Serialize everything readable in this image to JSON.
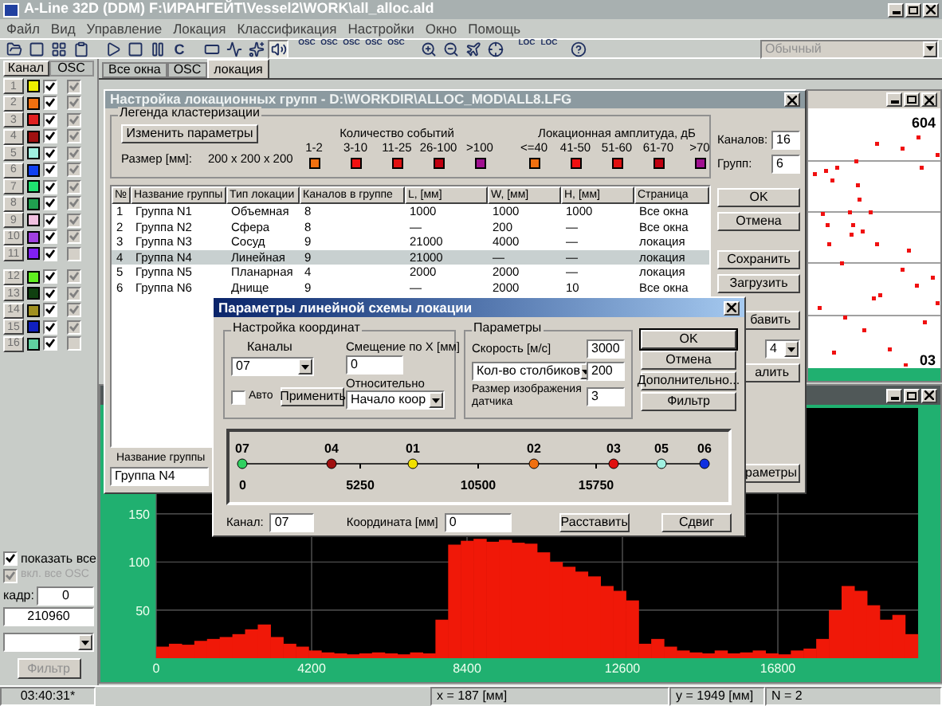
{
  "window": {
    "title": "A-Line 32D (DDM) F:\\ИРАНГЕЙТ\\Vessel2\\WORK\\all_alloc.ald"
  },
  "menu": [
    "Файл",
    "Вид",
    "Управление",
    "Локация",
    "Классификация",
    "Настройки",
    "Окно",
    "Помощь"
  ],
  "toolbar": {
    "reset_label": "C",
    "osc_buttons": [
      "OSC",
      "OSC",
      "OSC",
      "OSC",
      "OSC"
    ],
    "loc_buttons": [
      "LOC",
      "LOC"
    ],
    "style_combo": {
      "value": "Обычный",
      "disabled": true
    }
  },
  "left_panel": {
    "tabs": [
      {
        "label": "Канал",
        "selected": true
      },
      {
        "label": "OSC",
        "selected": false
      }
    ],
    "channel_groups": [
      [
        {
          "number": "1",
          "color": "#f0f000",
          "visible": true,
          "osc": true
        },
        {
          "number": "2",
          "color": "#f07010",
          "visible": true,
          "osc": true
        },
        {
          "number": "3",
          "color": "#e02020",
          "visible": true,
          "osc": true
        },
        {
          "number": "4",
          "color": "#a01010",
          "visible": true,
          "osc": true
        },
        {
          "number": "5",
          "color": "#a0f0e0",
          "visible": true,
          "osc": true
        },
        {
          "number": "6",
          "color": "#1040f0",
          "visible": true,
          "osc": true
        },
        {
          "number": "7",
          "color": "#20e070",
          "visible": true,
          "osc": true
        },
        {
          "number": "8",
          "color": "#20a050",
          "visible": true,
          "osc": true
        },
        {
          "number": "9",
          "color": "#f0c0e0",
          "visible": true,
          "osc": true
        },
        {
          "number": "10",
          "color": "#a040e0",
          "visible": true,
          "osc": true
        },
        {
          "number": "11",
          "color": "#8020f0",
          "visible": true,
          "osc": false
        }
      ],
      [
        {
          "number": "12",
          "color": "#60f020",
          "visible": true,
          "osc": true
        },
        {
          "number": "13",
          "color": "#104010",
          "visible": true,
          "osc": true
        },
        {
          "number": "14",
          "color": "#a09020",
          "visible": true,
          "osc": true
        },
        {
          "number": "15",
          "color": "#1020c0",
          "visible": true,
          "osc": true
        },
        {
          "number": "16",
          "color": "#60d0a0",
          "visible": true,
          "osc": false
        }
      ]
    ],
    "show_all": {
      "label": "показать все",
      "checked": true
    },
    "all_osc": {
      "label": "вкл. все OSC",
      "checked": true,
      "disabled": true
    },
    "frame_label": "кадр:",
    "frame_value": "0",
    "counter": "210960",
    "filter_button": {
      "label": "Фильтр",
      "disabled": true
    }
  },
  "tabs": [
    {
      "label": "Все окна",
      "selected": false
    },
    {
      "label": "OSC",
      "selected": false
    },
    {
      "label": "локация",
      "selected": true
    }
  ],
  "group_dialog": {
    "title": "Настройка локационных групп - D:\\WORKDIR\\ALLOC_MOD\\ALL8.LFG",
    "legend": {
      "title": "Легенда кластеризации",
      "change_button": "Изменить параметры",
      "size_label": "Размер [мм]:",
      "size_value": "200 x 200 x 200",
      "count_title": "Количество событий",
      "count_bins": [
        {
          "label": "1-2",
          "color": "#f07010"
        },
        {
          "label": "3-10",
          "color": "#f01010"
        },
        {
          "label": "11-25",
          "color": "#e01010"
        },
        {
          "label": "26-100",
          "color": "#c00010"
        },
        {
          "label": ">100",
          "color": "#a01090"
        }
      ],
      "amp_title": "Локационная амплитуда, дБ",
      "amp_bins": [
        {
          "label": "<=40",
          "color": "#f07010"
        },
        {
          "label": "41-50",
          "color": "#f01010"
        },
        {
          "label": "51-60",
          "color": "#e01010"
        },
        {
          "label": "61-70",
          "color": "#c00010"
        },
        {
          "label": ">70",
          "color": "#a01090"
        }
      ]
    },
    "channels_label": "Каналов:",
    "channels_value": "16",
    "groups_label": "Групп:",
    "groups_value": "6",
    "table": {
      "columns": [
        "№",
        "Название группы",
        "Тип локации",
        "Каналов в группе",
        "L, [мм]",
        "W, [мм]",
        "H, [мм]",
        "Страница"
      ],
      "rows": [
        {
          "cells": [
            "1",
            "Группа N1",
            "Объемная",
            "8",
            "1000",
            "1000",
            "1000",
            "Все окна"
          ],
          "selected": false
        },
        {
          "cells": [
            "2",
            "Группа N2",
            "Сфера",
            "8",
            "—",
            "200",
            "—",
            "Все окна"
          ],
          "selected": false
        },
        {
          "cells": [
            "3",
            "Группа N3",
            "Сосуд",
            "9",
            "21000",
            "4000",
            "—",
            "локация"
          ],
          "selected": false
        },
        {
          "cells": [
            "4",
            "Группа N4",
            "Линейная",
            "9",
            "21000",
            "—",
            "—",
            "локация"
          ],
          "selected": true
        },
        {
          "cells": [
            "5",
            "Группа N5",
            "Планарная",
            "4",
            "2000",
            "2000",
            "—",
            "локация"
          ],
          "selected": false
        },
        {
          "cells": [
            "6",
            "Группа N6",
            "Днище",
            "9",
            "—",
            "2000",
            "10",
            "Все окна"
          ],
          "selected": false
        }
      ]
    },
    "buttons": [
      "OK",
      "Отмена",
      "Сохранить",
      "Загрузить"
    ],
    "add_button": "бавить",
    "count_combo": "4",
    "delete_button": "алить",
    "params_button": "раметры",
    "name_label": "Название группы",
    "name_value": "Группа N4"
  },
  "scatter_window": {
    "labels": [
      "604",
      "03"
    ]
  },
  "histogram_window": {
    "chart_data": {
      "type": "bar",
      "grid": true,
      "xlim": [
        0,
        20590
      ],
      "ylim": [
        0,
        260
      ],
      "xticks": [
        0,
        4200,
        8400,
        12600,
        16800
      ],
      "yticks": [
        50,
        100,
        150
      ],
      "x": [
        172,
        515,
        858,
        1201,
        1544,
        1887,
        2230,
        2573,
        2916,
        3259,
        3602,
        3945,
        4288,
        4631,
        4974,
        5317,
        5660,
        6003,
        6346,
        6689,
        7032,
        7375,
        7718,
        8061,
        8404,
        8747,
        9090,
        9433,
        9776,
        10119,
        10462,
        10805,
        11148,
        11491,
        11834,
        12177,
        12520,
        12863,
        13206,
        13549,
        13892,
        14235,
        14578,
        14921,
        15264,
        15607,
        15950,
        16293,
        16636,
        16979,
        17322,
        17665,
        18008,
        18351,
        18694,
        19037,
        19380,
        19723,
        20066,
        20409
      ],
      "values": [
        12,
        15,
        14,
        18,
        20,
        22,
        25,
        30,
        35,
        22,
        15,
        12,
        8,
        6,
        5,
        4,
        5,
        6,
        5,
        4,
        6,
        5,
        40,
        118,
        122,
        124,
        121,
        123,
        120,
        119,
        110,
        100,
        95,
        90,
        85,
        75,
        70,
        60,
        15,
        20,
        12,
        8,
        6,
        5,
        8,
        5,
        6,
        8,
        5,
        4,
        8,
        10,
        20,
        50,
        75,
        70,
        55,
        40,
        45,
        25
      ]
    }
  },
  "scheme_dialog": {
    "title": "Параметры линейной схемы локации",
    "coords": {
      "title": "Настройка координат",
      "channels_label": "Каналы",
      "channel_value": "07",
      "offset_label": "Смещение по X [мм]",
      "offset_value": "0",
      "relative_label": "Относительно",
      "relative_value": "Начало коор",
      "auto": {
        "label": "Авто",
        "checked": false
      },
      "apply_button": "Применить"
    },
    "params": {
      "title": "Параметры",
      "speed_label": "Скорость [м/с]",
      "speed_value": "3000",
      "columns_combo": "Кол-во столбиков",
      "columns_value": "200",
      "sensor_size_label": "Размер изображения датчика",
      "sensor_size_value": "3"
    },
    "buttons": [
      "OK",
      "Отмена",
      "Дополнительно...",
      "Фильтр"
    ],
    "scale": {
      "ticks": [
        "0",
        "5250",
        "10500",
        "15750"
      ],
      "sensors": [
        {
          "label": "07",
          "color": "#30d060"
        },
        {
          "label": "04",
          "color": "#a01010"
        },
        {
          "label": "01",
          "color": "#f0e000"
        },
        {
          "label": "02",
          "color": "#f07010"
        },
        {
          "label": "03",
          "color": "#e01010"
        },
        {
          "label": "05",
          "color": "#a0f0e0"
        },
        {
          "label": "06",
          "color": "#1030e0"
        }
      ]
    },
    "channel_label": "Канал:",
    "channel_value": "07",
    "coord_label": "Координата [мм]",
    "coord_value": "0",
    "arrange_button": "Расставить",
    "shift_button": "Сдвиг"
  },
  "status_bar": [
    "03:40:31*",
    "x = 187 [мм]",
    "y = 1949 [мм]",
    "N = 2"
  ]
}
